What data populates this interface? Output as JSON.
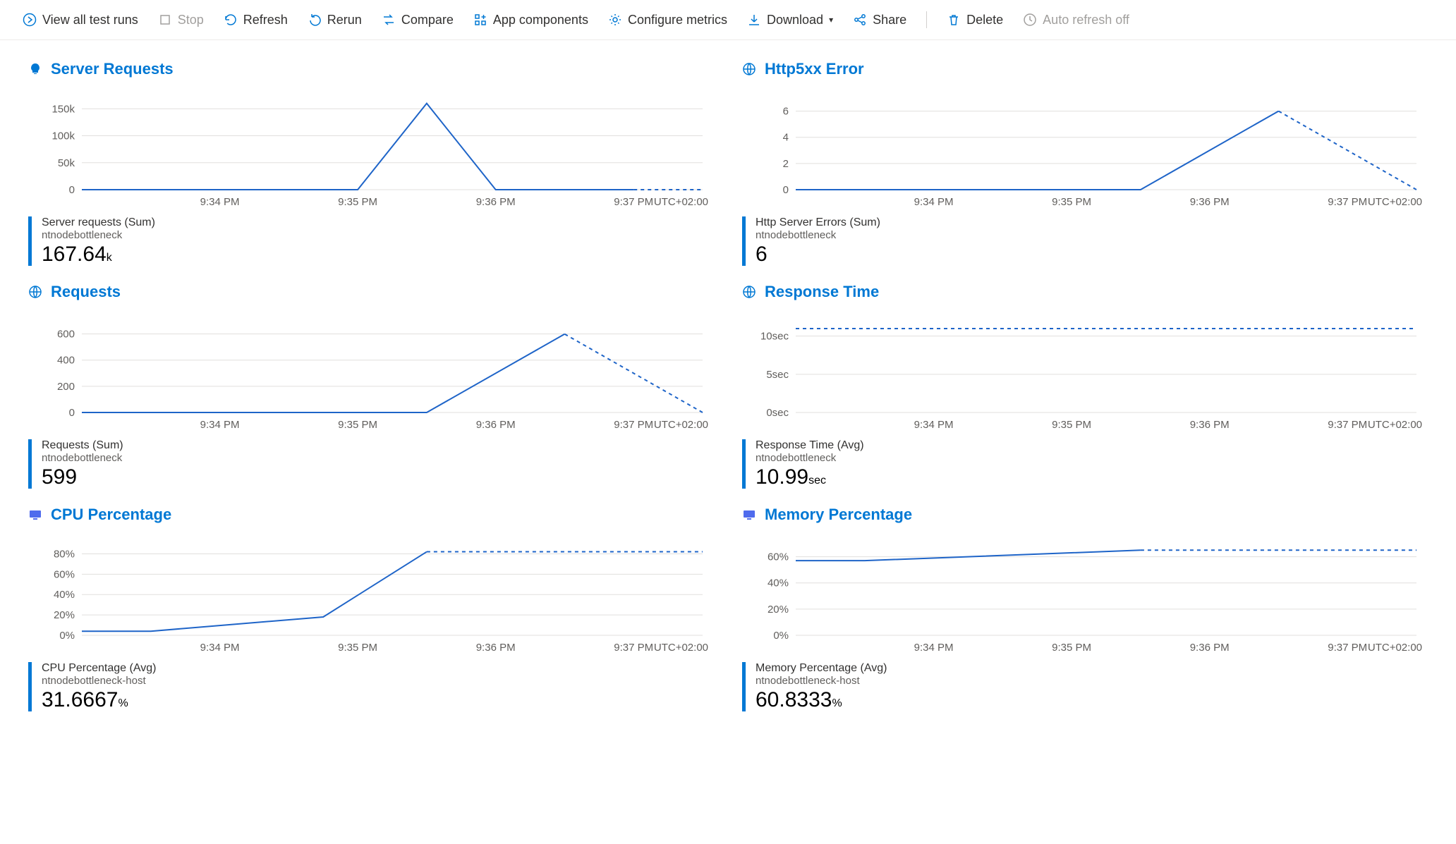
{
  "toolbar": {
    "view_all": "View all test runs",
    "stop": "Stop",
    "refresh": "Refresh",
    "rerun": "Rerun",
    "compare": "Compare",
    "app_components": "App components",
    "configure_metrics": "Configure metrics",
    "download": "Download",
    "share": "Share",
    "delete": "Delete",
    "auto_refresh": "Auto refresh off"
  },
  "common": {
    "tz": "UTC+02:00",
    "x_labels": [
      "9:34 PM",
      "9:35 PM",
      "9:36 PM",
      "9:37 PM"
    ]
  },
  "cards": {
    "server_requests": {
      "title": "Server Requests",
      "metric_label": "Server requests (Sum)",
      "metric_sub": "ntnodebottleneck",
      "metric_val": "167.64",
      "metric_unit": "k"
    },
    "http5xx": {
      "title": "Http5xx Error",
      "metric_label": "Http Server Errors (Sum)",
      "metric_sub": "ntnodebottleneck",
      "metric_val": "6",
      "metric_unit": ""
    },
    "requests": {
      "title": "Requests",
      "metric_label": "Requests (Sum)",
      "metric_sub": "ntnodebottleneck",
      "metric_val": "599",
      "metric_unit": ""
    },
    "response_time": {
      "title": "Response Time",
      "metric_label": "Response Time (Avg)",
      "metric_sub": "ntnodebottleneck",
      "metric_val": "10.99",
      "metric_unit": "sec"
    },
    "cpu": {
      "title": "CPU Percentage",
      "metric_label": "CPU Percentage (Avg)",
      "metric_sub": "ntnodebottleneck-host",
      "metric_val": "31.6667",
      "metric_unit": "%"
    },
    "memory": {
      "title": "Memory Percentage",
      "metric_label": "Memory Percentage (Avg)",
      "metric_sub": "ntnodebottleneck-host",
      "metric_val": "60.8333",
      "metric_unit": "%"
    }
  },
  "chart_data": [
    {
      "id": "server_requests",
      "type": "line",
      "title": "Server Requests",
      "x": [
        "9:33 PM",
        "9:34 PM",
        "9:35 PM",
        "9:35:30 PM",
        "9:36 PM",
        "9:37 PM",
        "9:37:30 PM"
      ],
      "y": [
        0,
        0,
        0,
        160000,
        0,
        0,
        0
      ],
      "solid_until": 5,
      "y_ticks": [
        0,
        50000,
        100000,
        150000
      ],
      "y_tick_labels": [
        "0",
        "50k",
        "100k",
        "150k"
      ],
      "ylim": [
        0,
        170000
      ]
    },
    {
      "id": "http5xx",
      "type": "line",
      "title": "Http5xx Error",
      "x": [
        "9:33 PM",
        "9:34 PM",
        "9:35 PM",
        "9:35:30 PM",
        "9:36:30 PM",
        "9:37:30 PM"
      ],
      "y": [
        0,
        0,
        0,
        0,
        6,
        0
      ],
      "solid_until": 4,
      "y_ticks": [
        0,
        2,
        4,
        6
      ],
      "y_tick_labels": [
        "0",
        "2",
        "4",
        "6"
      ],
      "ylim": [
        0,
        7
      ]
    },
    {
      "id": "requests",
      "type": "line",
      "title": "Requests",
      "x": [
        "9:33 PM",
        "9:34 PM",
        "9:35 PM",
        "9:35:30 PM",
        "9:36:30 PM",
        "9:37:30 PM"
      ],
      "y": [
        0,
        0,
        0,
        0,
        599,
        0
      ],
      "solid_until": 4,
      "y_ticks": [
        0,
        200,
        400,
        600
      ],
      "y_tick_labels": [
        "0",
        "200",
        "400",
        "600"
      ],
      "ylim": [
        0,
        700
      ]
    },
    {
      "id": "response_time",
      "type": "line",
      "title": "Response Time",
      "x": [
        "9:33 PM",
        "9:37:30 PM"
      ],
      "y": [
        10.99,
        10.99
      ],
      "solid_until": 0,
      "y_ticks": [
        0,
        5,
        10
      ],
      "y_tick_labels": [
        "0sec",
        "5sec",
        "10sec"
      ],
      "ylim": [
        0,
        12
      ]
    },
    {
      "id": "cpu",
      "type": "line",
      "title": "CPU Percentage",
      "x": [
        "9:33 PM",
        "9:33:30 PM",
        "9:34:45 PM",
        "9:35:30 PM",
        "9:37:30 PM"
      ],
      "y": [
        4,
        4,
        18,
        82,
        82
      ],
      "solid_until": 3,
      "y_ticks": [
        0,
        20,
        40,
        60,
        80
      ],
      "y_tick_labels": [
        "0%",
        "20%",
        "40%",
        "60%",
        "80%"
      ],
      "ylim": [
        0,
        90
      ]
    },
    {
      "id": "memory",
      "type": "line",
      "title": "Memory Percentage",
      "x": [
        "9:33 PM",
        "9:33:30 PM",
        "9:35:30 PM",
        "9:37:30 PM"
      ],
      "y": [
        57,
        57,
        65,
        65
      ],
      "solid_until": 2,
      "y_ticks": [
        0,
        20,
        40,
        60
      ],
      "y_tick_labels": [
        "0%",
        "20%",
        "40%",
        "60%"
      ],
      "ylim": [
        0,
        70
      ]
    }
  ]
}
